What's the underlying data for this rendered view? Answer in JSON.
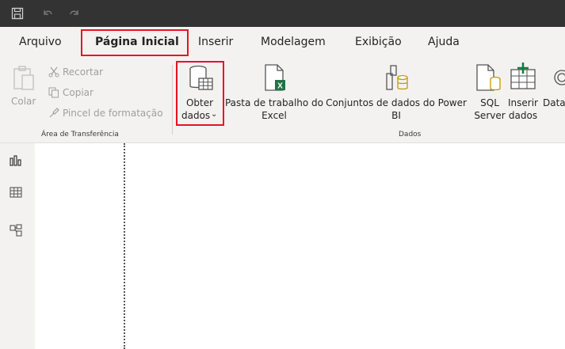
{
  "menu": {
    "tabs": [
      {
        "label": "Arquivo"
      },
      {
        "label": "Página Inicial"
      },
      {
        "label": "Inserir"
      },
      {
        "label": "Modelagem"
      },
      {
        "label": "Exibição"
      },
      {
        "label": "Ajuda"
      }
    ]
  },
  "ribbon": {
    "clipboard": {
      "paste": "Colar",
      "cut": "Recortar",
      "copy": "Copiar",
      "format_painter": "Pincel de formatação",
      "group_label": "Área de Transferência"
    },
    "data": {
      "get_data_line1": "Obter",
      "get_data_line2": "dados",
      "excel_line1": "Pasta de trabalho do",
      "excel_line2": "Excel",
      "datasets_line1": "Conjuntos de dados do Power",
      "datasets_line2": "BI",
      "sql_line1": "SQL",
      "sql_line2": "Server",
      "enter_line1": "Inserir",
      "enter_line2": "dados",
      "dataverse_partial": "Datav",
      "group_label": "Dados"
    }
  },
  "colors": {
    "titlebar": "#333333",
    "ribbon_bg": "#f3f2f1",
    "highlight": "#e81123",
    "excel_green": "#217346",
    "power_bi_yellow": "#f2c811"
  }
}
